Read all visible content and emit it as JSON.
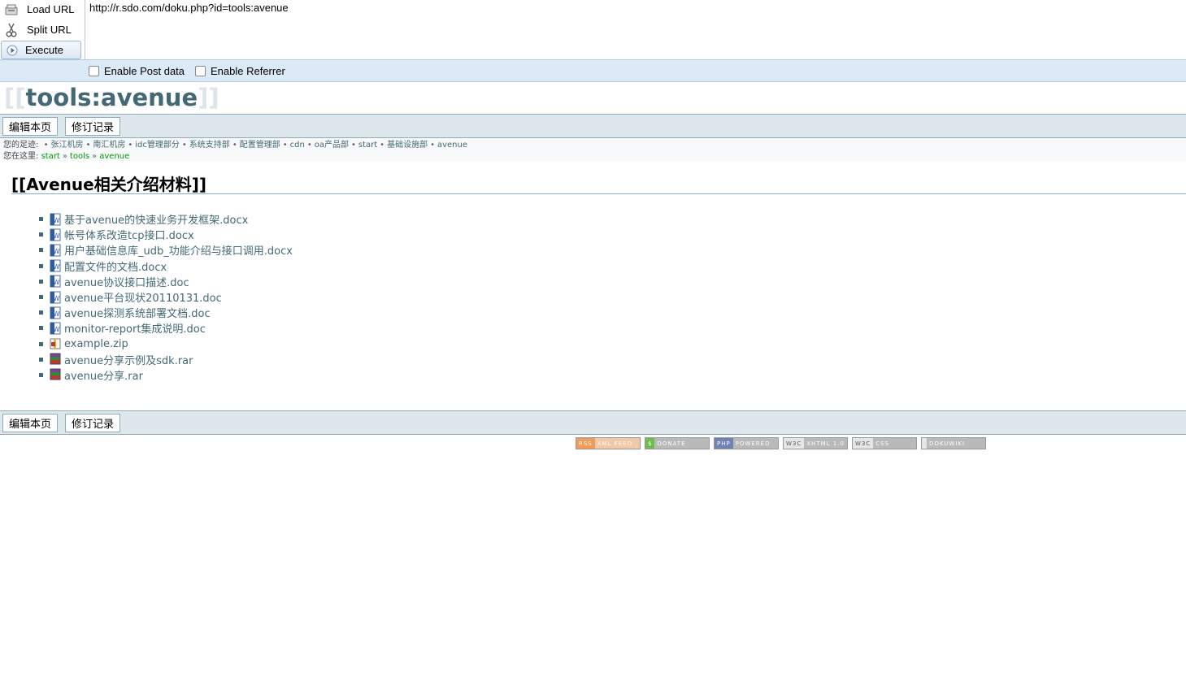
{
  "hackbar": {
    "load_url": "Load URL",
    "split_url": "Split URL",
    "execute": "Execute",
    "url_value": "http://r.sdo.com/doku.php?id=tools:avenue",
    "enable_post": "Enable Post data",
    "enable_referrer": "Enable Referrer"
  },
  "page": {
    "title_open": "[[",
    "title_name": "tools:avenue",
    "title_close": "]]",
    "edit_button": "编辑本页",
    "revisions_button": "修订记录",
    "trail_label": "您的足迹:",
    "trail": [
      "张江机房",
      "南汇机房",
      "idc管理部分",
      "系统支持部",
      "配置管理部",
      "cdn",
      "oa产品部",
      "start",
      "基础设施部",
      "avenue"
    ],
    "here_label": "您在这里:",
    "here": [
      "start",
      "tools",
      "avenue"
    ],
    "heading": "[[Avenue相关介绍材料]]"
  },
  "files": [
    {
      "name": "基于avenue的快速业务开发框架.docx",
      "icon": "word-doc-icon"
    },
    {
      "name": "帐号体系改造tcp接口.docx",
      "icon": "word-doc-icon"
    },
    {
      "name": "用户基础信息库_udb_功能介绍与接口调用.docx",
      "icon": "word-doc-icon"
    },
    {
      "name": "配置文件的文档.docx",
      "icon": "word-doc-icon"
    },
    {
      "name": "avenue协议接口描述.doc",
      "icon": "word-doc-icon"
    },
    {
      "name": "avenue平台现状20110131.doc",
      "icon": "word-doc-icon"
    },
    {
      "name": "avenue探测系统部署文档.doc",
      "icon": "word-doc-icon"
    },
    {
      "name": "monitor-report集成说明.doc",
      "icon": "word-doc-icon"
    },
    {
      "name": "example.zip",
      "icon": "zip-archive-icon"
    },
    {
      "name": "avenue分享示例及sdk.rar",
      "icon": "rar-archive-icon"
    },
    {
      "name": "avenue分享.rar",
      "icon": "rar-archive-icon"
    }
  ],
  "badges": [
    {
      "left": "RSS",
      "right": "XML FEED",
      "lcolor": "#f19b5a",
      "rcolor": "#f2c9a8"
    },
    {
      "left": "$",
      "right": "DONATE",
      "lcolor": "#6cbf4d",
      "rcolor": "#b9b9b9"
    },
    {
      "left": "PHP",
      "right": "POWERED",
      "lcolor": "#6f83b6",
      "rcolor": "#b9b9b9"
    },
    {
      "left": "W3C",
      "right": "XHTML 1.0",
      "lcolor": "#e6e6e6",
      "rcolor": "#b9b9b9"
    },
    {
      "left": "W3C",
      "right": "CSS",
      "lcolor": "#e6e6e6",
      "rcolor": "#b9b9b9"
    },
    {
      "left": "",
      "right": "DOKUWIKI",
      "lcolor": "#e6e6e6",
      "rcolor": "#b9b9b9"
    }
  ]
}
